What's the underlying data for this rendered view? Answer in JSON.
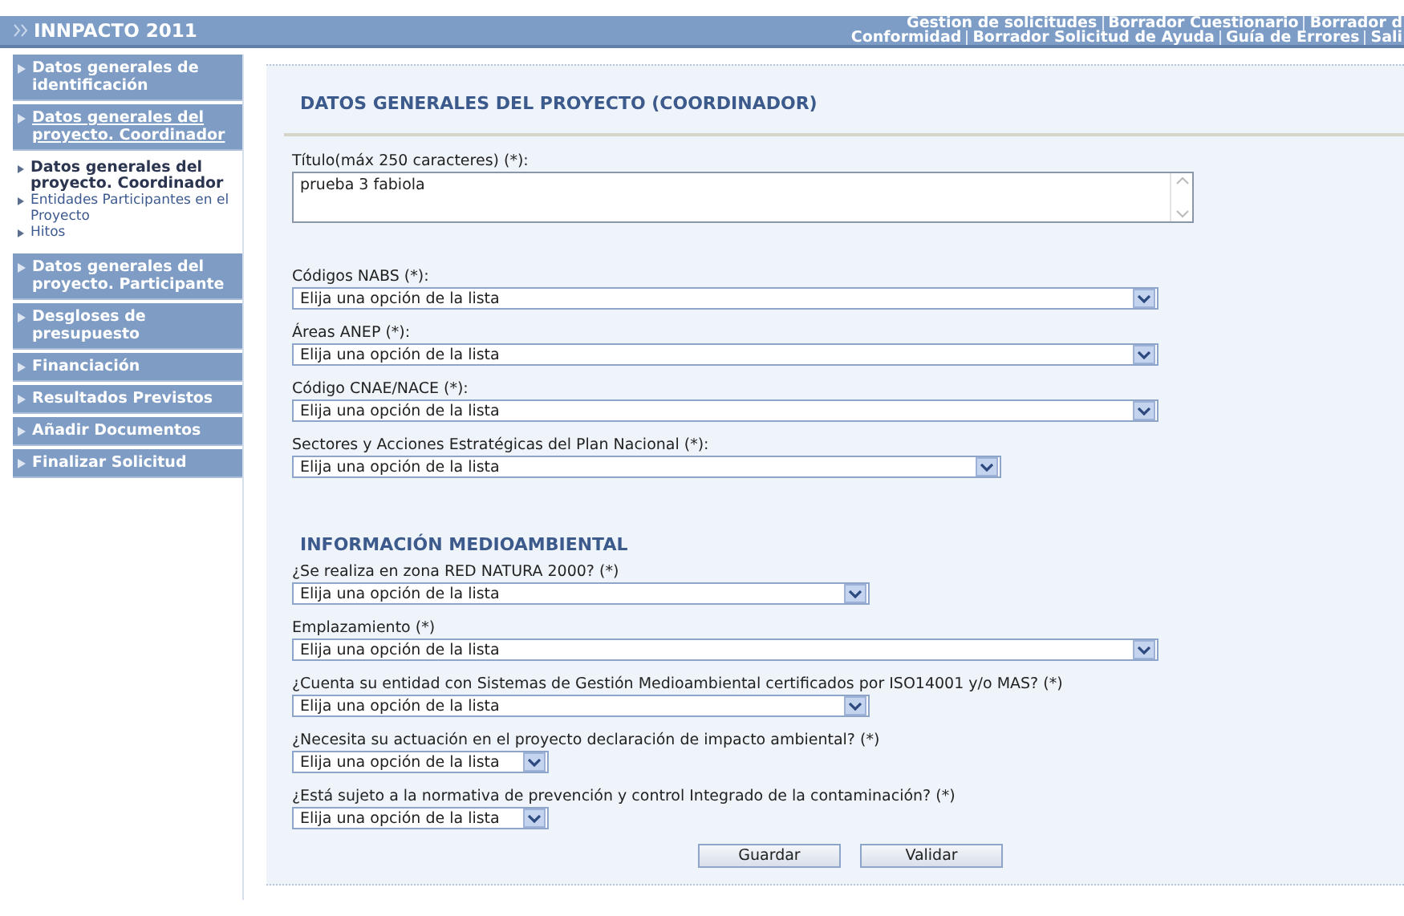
{
  "header": {
    "title": "INNPACTO 2011",
    "links_line_1": [
      "Gestion de solicitudes",
      "Borrador Cuestionario",
      "Borrador d"
    ],
    "links_line_2": [
      "Conformidad",
      "Borrador Solicitud de Ayuda",
      "Guía de Errores",
      "Sali"
    ]
  },
  "sidebar": {
    "items": [
      {
        "label": "Datos generales de identificación",
        "selected": false
      },
      {
        "label": "Datos generales del proyecto. Coordinador",
        "selected": true,
        "children": [
          {
            "label": "Datos generales del proyecto. Coordinador",
            "selected": true
          },
          {
            "label": "Entidades Participantes en el Proyecto",
            "selected": false
          },
          {
            "label": "Hitos",
            "selected": false
          }
        ]
      },
      {
        "label": "Datos generales del proyecto. Participante",
        "selected": false
      },
      {
        "label": "Desgloses de presupuesto",
        "selected": false
      },
      {
        "label": "Financiación",
        "selected": false
      },
      {
        "label": "Resultados Previstos",
        "selected": false
      },
      {
        "label": "Añadir Documentos",
        "selected": false
      },
      {
        "label": "Finalizar Solicitud",
        "selected": false
      }
    ]
  },
  "form": {
    "title": "DATOS GENERALES DEL PROYECTO (COORDINADOR)",
    "title_field": {
      "label": "Título(máx 250 caracteres)  (*):",
      "value": "prueba 3 fabiola"
    },
    "selects": [
      {
        "label": "Códigos NABS  (*):",
        "value": "Elija una opción de la lista",
        "kind": "long"
      },
      {
        "label": "Áreas ANEP  (*):",
        "value": "Elija una opción de la lista",
        "kind": "long"
      },
      {
        "label": "Código CNAE/NACE  (*):",
        "value": "Elija una opción de la lista",
        "kind": "long"
      },
      {
        "label": "Sectores y Acciones Estratégicas del Plan Nacional  (*):",
        "value": "Elija una opción de la lista",
        "kind": "wide"
      }
    ],
    "section_title": "INFORMACIÓN MEDIOAMBIENTAL",
    "env_selects": [
      {
        "label": "¿Se realiza en zona RED NATURA 2000? (*)",
        "value": "Elija una opción de la lista",
        "kind": "medium"
      },
      {
        "label": "Emplazamiento  (*)",
        "value": "Elija una opción de la lista",
        "kind": "long"
      },
      {
        "label": "¿Cuenta su entidad con Sistemas de Gestión Medioambiental certificados por ISO14001 y/o MAS? (*)",
        "value": "Elija una opción de la lista",
        "kind": "medium"
      },
      {
        "label": "¿Necesita su actuación en el proyecto declaración de impacto ambiental? (*)",
        "value": "Elija una opción de la lista",
        "kind": "short"
      },
      {
        "label": "¿Está sujeto a la normativa de prevención y control Integrado de la contaminación? (*)",
        "value": "Elija una opción de la lista",
        "kind": "short"
      }
    ],
    "buttons": [
      "Guardar",
      "Validar"
    ]
  }
}
